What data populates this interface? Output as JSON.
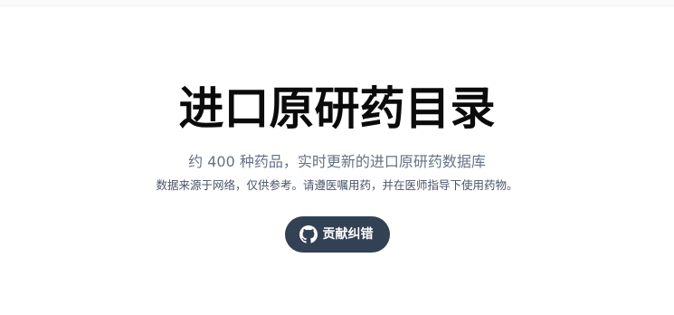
{
  "hero": {
    "title": "进口原研药目录",
    "subtitle": "约 400 种药品，实时更新的进口原研药数据库",
    "disclaimer": "数据来源于网络，仅供参考。请遵医嘱用药，并在医师指导下使用药物。",
    "contribute_button": {
      "label": "贡献纠错",
      "icon": "github-icon"
    }
  },
  "colors": {
    "title": "#0b0b0c",
    "subtitle": "#657185",
    "disclaimer": "#4a5568",
    "button_bg": "#334155",
    "button_text": "#ffffff"
  }
}
